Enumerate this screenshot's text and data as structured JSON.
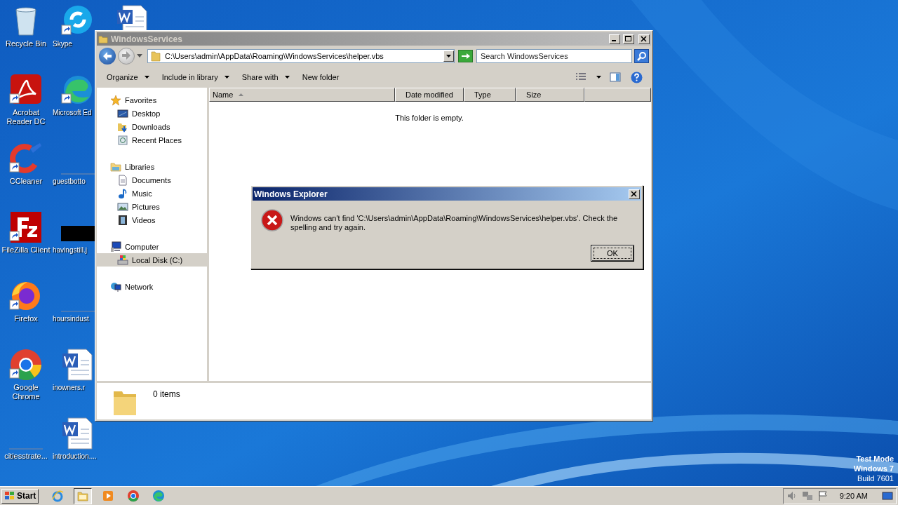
{
  "desktop": {
    "columns": [
      [
        {
          "label": "Recycle Bin",
          "kind": "recycle",
          "shortcut": false
        },
        {
          "label": "Acrobat Reader DC",
          "kind": "acrobat",
          "shortcut": true
        },
        {
          "label": "CCleaner",
          "kind": "ccleaner",
          "shortcut": true
        },
        {
          "label": "FileZilla Client",
          "kind": "filezilla",
          "shortcut": true
        },
        {
          "label": "Firefox",
          "kind": "firefox",
          "shortcut": true
        },
        {
          "label": "Google Chrome",
          "kind": "chrome",
          "shortcut": true
        },
        {
          "label": "citiesstrate...",
          "kind": "blank",
          "shortcut": false
        }
      ],
      [
        {
          "label": "Skype",
          "kind": "skype",
          "shortcut": true
        },
        {
          "label": "Microsoft Ed",
          "kind": "edge",
          "shortcut": true
        },
        {
          "label": "guestbotto",
          "kind": "blank",
          "shortcut": false
        },
        {
          "label": "havingstill.j",
          "kind": "black",
          "shortcut": false
        },
        {
          "label": "hoursindust",
          "kind": "blank",
          "shortcut": false
        },
        {
          "label": "inowners.r",
          "kind": "word",
          "shortcut": false
        },
        {
          "label": "introduction....",
          "kind": "word",
          "shortcut": false
        }
      ],
      [
        {
          "kind": "word",
          "shortcut": false
        }
      ]
    ],
    "watermark_lines": [
      {
        "text": "Test Mode",
        "bold": true
      },
      {
        "text": "Windows 7",
        "bold": true
      },
      {
        "text": "Build 7601",
        "bold": false
      }
    ]
  },
  "explorer": {
    "title": "WindowsServices",
    "address": "C:\\Users\\admin\\AppData\\Roaming\\WindowsServices\\helper.vbs",
    "search": {
      "placeholder": "Search WindowsServices"
    },
    "toolbar": [
      {
        "label": "Organize",
        "dropdown": true
      },
      {
        "label": "Include in library",
        "dropdown": true
      },
      {
        "label": "Share with",
        "dropdown": true
      },
      {
        "label": "New folder",
        "dropdown": false
      }
    ],
    "sidebar": {
      "groups": [
        {
          "label": "Favorites",
          "kind": "star",
          "selected": false,
          "children": [
            {
              "label": "Desktop",
              "kind": "desktop",
              "selected": false
            },
            {
              "label": "Downloads",
              "kind": "downloads",
              "selected": false
            },
            {
              "label": "Recent Places",
              "kind": "recent",
              "selected": false
            }
          ]
        },
        {
          "label": "Libraries",
          "kind": "libraries",
          "selected": false,
          "children": [
            {
              "label": "Documents",
              "kind": "documents",
              "selected": false
            },
            {
              "label": "Music",
              "kind": "music",
              "selected": false
            },
            {
              "label": "Pictures",
              "kind": "pictures",
              "selected": false
            },
            {
              "label": "Videos",
              "kind": "videos",
              "selected": false
            }
          ]
        },
        {
          "label": "Computer",
          "kind": "computer",
          "selected": false,
          "children": [
            {
              "label": "Local Disk (C:)",
              "kind": "disk",
              "selected": true
            }
          ]
        },
        {
          "label": "Network",
          "kind": "network",
          "selected": false
        }
      ]
    },
    "columns": [
      {
        "label": "Name",
        "sorted": true
      },
      {
        "label": "Date modified",
        "sorted": false
      },
      {
        "label": "Type",
        "sorted": false
      },
      {
        "label": "Size",
        "sorted": false
      }
    ],
    "empty_message": "This folder is empty.",
    "status": "0 items"
  },
  "dialog": {
    "title": "Windows Explorer",
    "message": "Windows can't find 'C:\\Users\\admin\\AppData\\Roaming\\WindowsServices\\helper.vbs'.  Check the spelling and try again.",
    "buttons": [
      "OK"
    ]
  },
  "taskbar": {
    "start": "Start",
    "apps": [
      {
        "kind": "ie",
        "active": false
      },
      {
        "kind": "explorer",
        "active": true
      },
      {
        "kind": "media",
        "active": false
      },
      {
        "kind": "chrome",
        "active": false
      },
      {
        "kind": "edge",
        "active": false
      }
    ],
    "clock": "9:20 AM"
  }
}
